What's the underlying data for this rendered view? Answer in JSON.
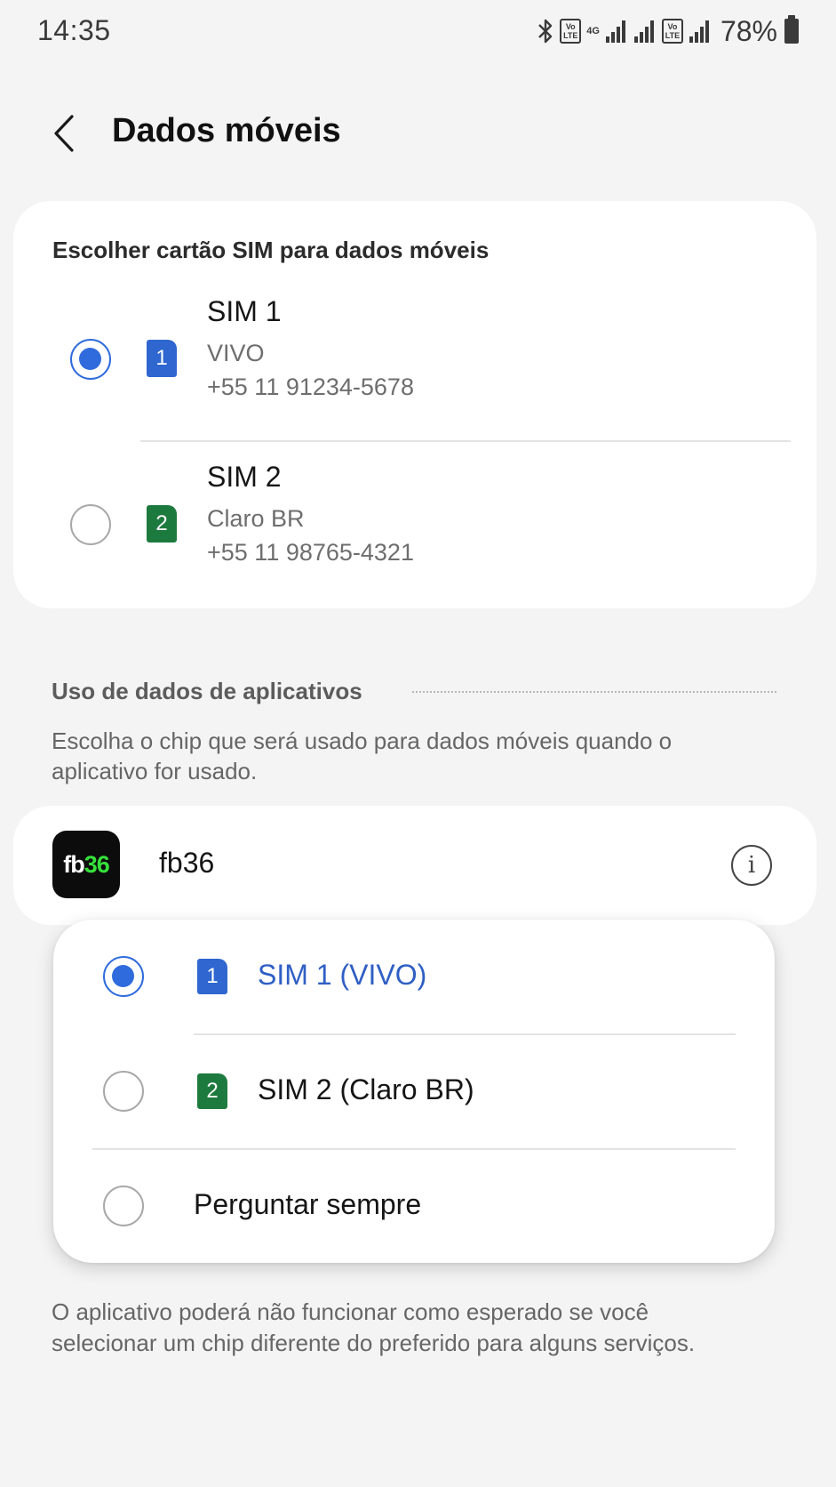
{
  "status_bar": {
    "time": "14:35",
    "volte_1": "Vo LTE",
    "network": "4G",
    "volte_2": "Vo LTE",
    "battery": "78%",
    "icons": [
      "bluetooth-icon",
      "volte-icon",
      "4g-icon",
      "signal-icon",
      "signal-icon",
      "volte-icon",
      "signal-icon",
      "battery-icon"
    ]
  },
  "header": {
    "title": "Dados móveis",
    "back_icon": "chevron-left-icon"
  },
  "sim_selection": {
    "title": "Escolher cartão SIM para dados móveis",
    "options": [
      {
        "name": "SIM 1",
        "badge": "1",
        "carrier": "VIVO",
        "number": "+55 11 91234-5678",
        "selected": true,
        "color": "#2f66d0"
      },
      {
        "name": "SIM 2",
        "badge": "2",
        "carrier": "Claro BR",
        "number": "+55 11 98765-4321",
        "selected": false,
        "color": "#1d7a3e"
      }
    ]
  },
  "app_data": {
    "section_title": "Uso de dados de aplicativos",
    "description": "Escolha o chip que será usado para dados móveis quando o aplicativo for usado.",
    "app": {
      "name": "fb36",
      "icon_text_white": "fb",
      "icon_text_green": "36",
      "info_icon": "info-icon"
    }
  },
  "popup": {
    "options": [
      {
        "label": "SIM 1 (VIVO)",
        "badge": "1",
        "selected": true
      },
      {
        "label": "SIM 2 (Claro BR)",
        "badge": "2",
        "selected": false
      },
      {
        "label": "Perguntar sempre",
        "selected": false
      }
    ]
  },
  "footer_note": "O aplicativo poderá não funcionar como esperado se você selecionar um chip diferente do preferido para alguns serviços.",
  "colors": {
    "accent": "#2f6bdc",
    "sim1": "#2f66d0",
    "sim2": "#1d7a3e",
    "background": "#f4f4f4"
  }
}
